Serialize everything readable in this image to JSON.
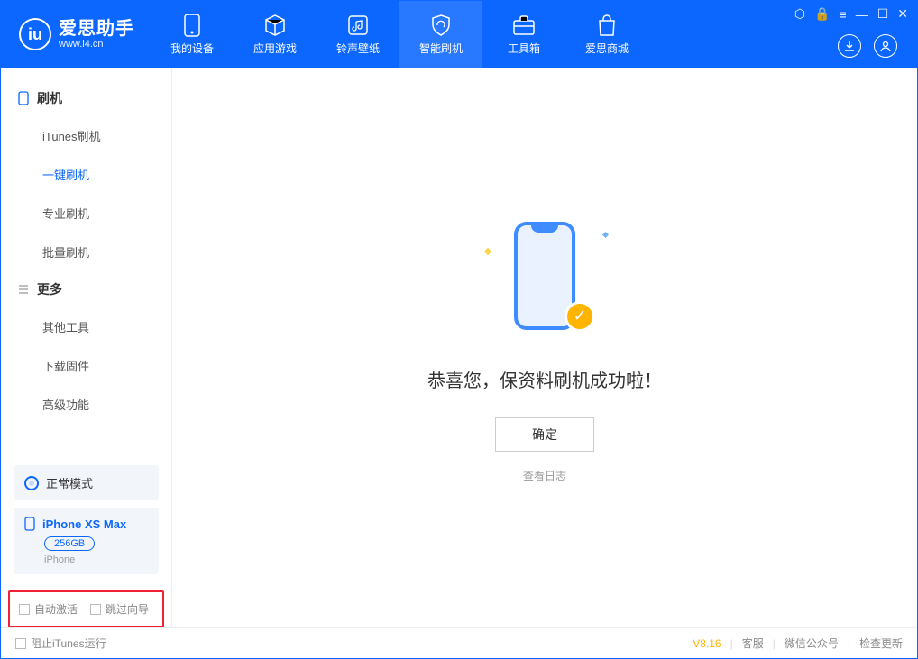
{
  "app": {
    "title": "爱思助手",
    "subtitle": "www.i4.cn"
  },
  "nav": {
    "items": [
      {
        "label": "我的设备"
      },
      {
        "label": "应用游戏"
      },
      {
        "label": "铃声壁纸"
      },
      {
        "label": "智能刷机"
      },
      {
        "label": "工具箱"
      },
      {
        "label": "爱思商城"
      }
    ]
  },
  "sidebar": {
    "section1": {
      "title": "刷机",
      "items": [
        "iTunes刷机",
        "一键刷机",
        "专业刷机",
        "批量刷机"
      ]
    },
    "section2": {
      "title": "更多",
      "items": [
        "其他工具",
        "下载固件",
        "高级功能"
      ]
    }
  },
  "mode": {
    "label": "正常模式"
  },
  "device": {
    "name": "iPhone XS Max",
    "capacity": "256GB",
    "subtype": "iPhone"
  },
  "options": {
    "auto_activate": "自动激活",
    "skip_wizard": "跳过向导"
  },
  "main": {
    "title": "恭喜您，保资料刷机成功啦！",
    "ok_label": "确定",
    "view_log": "查看日志"
  },
  "footer": {
    "block_itunes": "阻止iTunes运行",
    "version": "V8.16",
    "links": [
      "客服",
      "微信公众号",
      "检查更新"
    ]
  }
}
